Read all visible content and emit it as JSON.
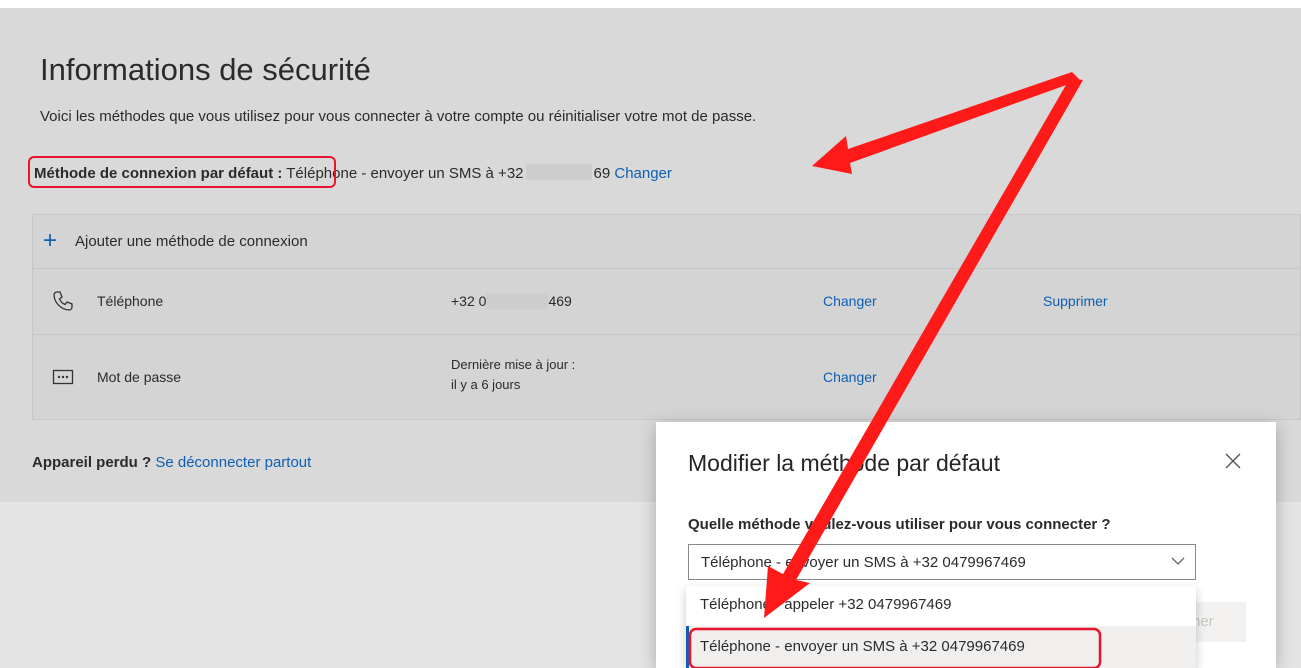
{
  "page": {
    "title": "Informations de sécurité",
    "subtitle": "Voici les méthodes que vous utilisez pour vous connecter à votre compte ou réinitialiser votre mot de passe.",
    "default_label": "Méthode de connexion par défaut :",
    "default_prefix": "Téléphone - envoyer un SMS à +32",
    "default_suffix": "69",
    "default_change": "Changer",
    "add_method": "Ajouter une méthode de connexion",
    "methods": [
      {
        "icon": "phone-icon",
        "name": "Téléphone",
        "value_prefix": "+32 0",
        "value_suffix": "469",
        "change": "Changer",
        "delete": "Supprimer"
      },
      {
        "icon": "password-icon",
        "name": "Mot de passe",
        "value_line1": "Dernière mise à jour :",
        "value_line2": "il y a 6 jours",
        "change": "Changer"
      }
    ],
    "lost_label": "Appareil perdu ?",
    "lost_link": "Se déconnecter partout"
  },
  "dialog": {
    "title": "Modifier la méthode par défaut",
    "question": "Quelle méthode voulez-vous utiliser pour vous connecter ?",
    "selected": "Téléphone - envoyer un SMS à +32 0479967469",
    "options": [
      "Téléphone - appeler +32 0479967469",
      "Téléphone - envoyer un SMS à +32 0479967469"
    ],
    "confirm_partial": "ner"
  },
  "colors": {
    "link": "#0d5fb5",
    "annotation_red": "#e8142a"
  }
}
